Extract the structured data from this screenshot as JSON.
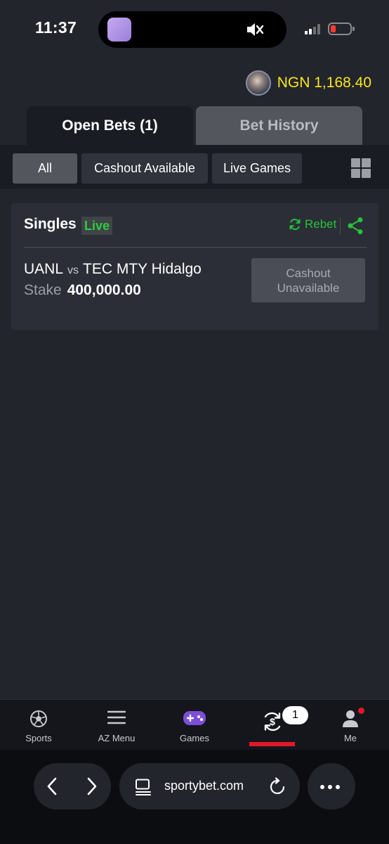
{
  "status_bar": {
    "time": "11:37"
  },
  "balance": {
    "text": "NGN 1,168.40"
  },
  "tabs": {
    "open_bets": "Open Bets (1)",
    "bet_history": "Bet History"
  },
  "filters": {
    "all": "All",
    "cashout_available": "Cashout Available",
    "live_games": "Live Games"
  },
  "bet_card": {
    "title": "Singles",
    "live_badge": "Live",
    "rebet": "Rebet",
    "home": "UANL",
    "vs": "vs",
    "away": "TEC MTY Hidalgo",
    "stake_label": "Stake",
    "stake_value": "400,000.00",
    "cashout_line1": "Cashout",
    "cashout_line2": "Unavailable"
  },
  "bottom_nav": {
    "sports": "Sports",
    "az_menu": "AZ Menu",
    "games": "Games",
    "open_bets_count": "1",
    "me": "Me"
  },
  "browser": {
    "url": "sportybet.com"
  },
  "colors": {
    "background": "#23252d",
    "balance": "#f8e71c",
    "live_green": "#2ecc40",
    "rebet_green": "#26c23d",
    "accent_red": "#e41827"
  }
}
